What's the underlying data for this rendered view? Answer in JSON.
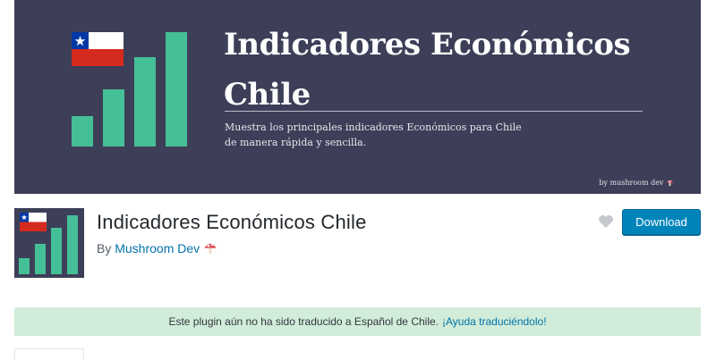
{
  "banner": {
    "title_line1": "Indicadores Económicos",
    "title_line2": "Chile",
    "description_line1": "Muestra los principales indicadores Económicos para Chile",
    "description_line2": "de manera rápida y sencilla.",
    "credit": "by mushroom dev",
    "bar_color": "#45bf97",
    "background_color": "#3d3f58",
    "flag_icon": "chile-flag-icon",
    "credit_icon": "mushroom-icon"
  },
  "plugin": {
    "icon": "chile-flag-bar-chart-icon",
    "title": "Indicadores Económicos Chile",
    "author_prefix": "By",
    "author_name": "Mushroom Dev",
    "author_icon": "mushroom-icon"
  },
  "actions": {
    "favorite_icon": "heart-icon",
    "download_label": "Download",
    "download_color": "#0085ba"
  },
  "notice": {
    "text": "Este plugin aún no ha sido traducido a Español de Chile.",
    "link_text": "¡Ayuda traduciéndolo!",
    "background_color": "#d1ecd9"
  }
}
